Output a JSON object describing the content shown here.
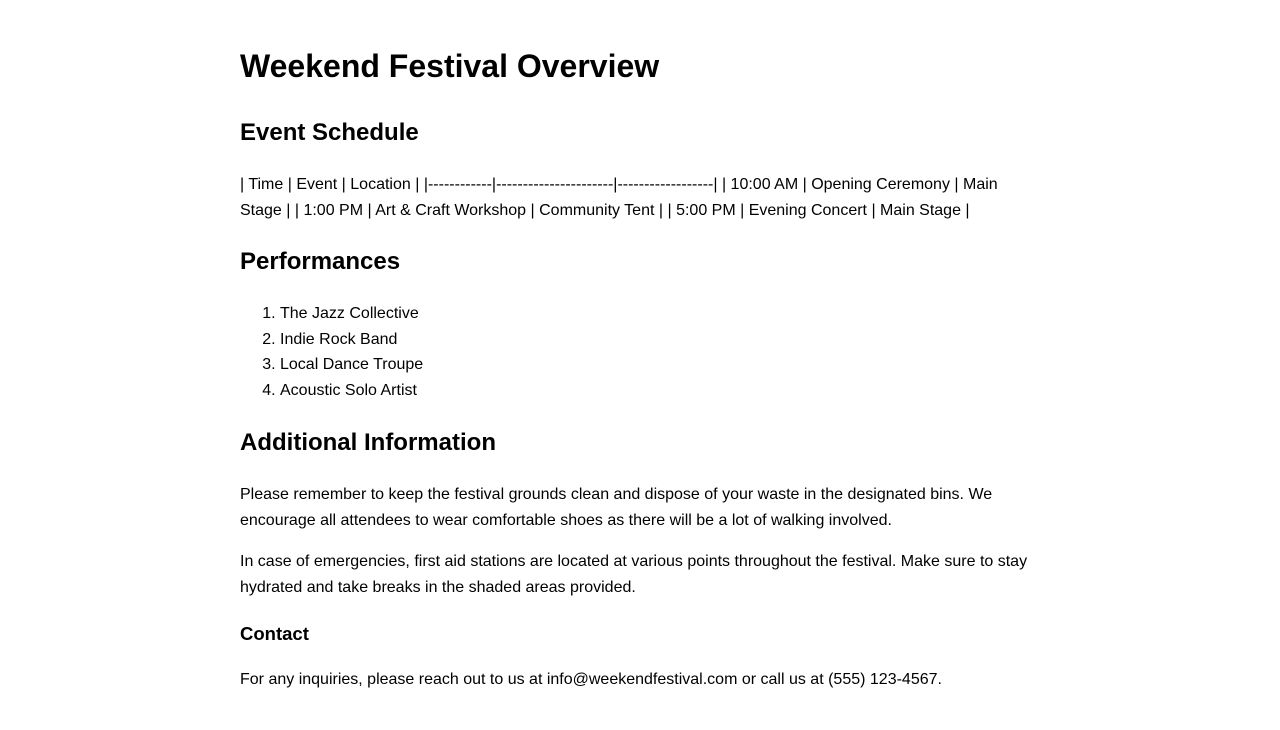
{
  "document": {
    "title": "Weekend Festival Overview",
    "sections": {
      "schedule": {
        "heading": "Event Schedule",
        "text": "| Time | Event | Location | |------------|----------------------|------------------| | 10:00 AM | Opening Ceremony | Main Stage | | 1:00 PM | Art & Craft Workshop | Community Tent | | 5:00 PM | Evening Concert | Main Stage |"
      },
      "performances": {
        "heading": "Performances",
        "items": [
          "The Jazz Collective",
          "Indie Rock Band",
          "Local Dance Troupe",
          "Acoustic Solo Artist"
        ]
      },
      "additional": {
        "heading": "Additional Information",
        "paragraphs": [
          "Please remember to keep the festival grounds clean and dispose of your waste in the designated bins. We encourage all attendees to wear comfortable shoes as there will be a lot of walking involved.",
          "In case of emergencies, first aid stations are located at various points throughout the festival. Make sure to stay hydrated and take breaks in the shaded areas provided."
        ]
      },
      "contact": {
        "heading": "Contact",
        "text": "For any inquiries, please reach out to us at info@weekendfestival.com or call us at (555) 123-4567."
      }
    }
  }
}
